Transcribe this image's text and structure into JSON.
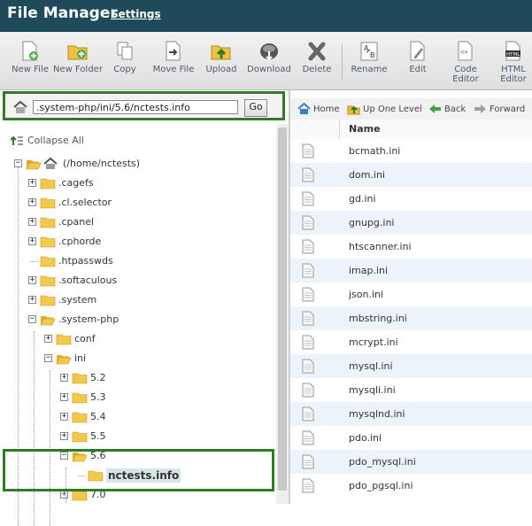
{
  "header": {
    "title": "File Manager",
    "settings_label": "Settings"
  },
  "toolbar": {
    "buttons": [
      {
        "label": "New File",
        "icon": "new-file-icon"
      },
      {
        "label": "New Folder",
        "icon": "new-folder-icon"
      },
      {
        "label": "Copy",
        "icon": "copy-icon"
      },
      {
        "label": "Move File",
        "icon": "move-file-icon"
      },
      {
        "label": "Upload",
        "icon": "upload-icon"
      },
      {
        "label": "Download",
        "icon": "download-icon"
      },
      {
        "label": "Delete",
        "icon": "delete-icon"
      },
      {
        "label": "Rename",
        "icon": "rename-icon"
      },
      {
        "label": "Edit",
        "icon": "edit-icon"
      },
      {
        "label": "Code Editor",
        "icon": "code-editor-icon"
      },
      {
        "label": "HTML Editor",
        "icon": "html-editor-icon"
      }
    ]
  },
  "path_bar": {
    "value": ".system-php/ini/5.6/nctests.info",
    "go_label": "Go"
  },
  "tree": {
    "collapse_all_label": "Collapse All",
    "root_label": "(/home/nctests)",
    "items": [
      {
        "label": ".cagefs",
        "level": 1,
        "expandable": true
      },
      {
        "label": ".cl.selector",
        "level": 1,
        "expandable": true
      },
      {
        "label": ".cpanel",
        "level": 1,
        "expandable": true
      },
      {
        "label": ".cphorde",
        "level": 1,
        "expandable": true
      },
      {
        "label": ".htpasswds",
        "level": 1,
        "expandable": false
      },
      {
        "label": ".softaculous",
        "level": 1,
        "expandable": true
      },
      {
        "label": ".system",
        "level": 1,
        "expandable": true
      },
      {
        "label": ".system-php",
        "level": 1,
        "expandable": true,
        "open": true
      },
      {
        "label": "conf",
        "level": 2,
        "expandable": true
      },
      {
        "label": "ini",
        "level": 2,
        "expandable": true,
        "open": true
      },
      {
        "label": "5.2",
        "level": 3,
        "expandable": true
      },
      {
        "label": "5.3",
        "level": 3,
        "expandable": true
      },
      {
        "label": "5.4",
        "level": 3,
        "expandable": true
      },
      {
        "label": "5.5",
        "level": 3,
        "expandable": true
      },
      {
        "label": "5.6",
        "level": 3,
        "expandable": true,
        "open": true
      },
      {
        "label": "nctests.info",
        "level": 4,
        "expandable": false,
        "selected": true
      },
      {
        "label": "7.0",
        "level": 3,
        "expandable": true
      }
    ]
  },
  "nav": {
    "home": "Home",
    "up": "Up One Level",
    "back": "Back",
    "forward": "Forward"
  },
  "files": {
    "column_name": "Name",
    "rows": [
      "bcmath.ini",
      "dom.ini",
      "gd.ini",
      "gnupg.ini",
      "htscanner.ini",
      "imap.ini",
      "json.ini",
      "mbstring.ini",
      "mcrypt.ini",
      "mysql.ini",
      "mysqli.ini",
      "mysqlnd.ini",
      "pdo.ini",
      "pdo_mysql.ini",
      "pdo_pgsql.ini"
    ]
  },
  "colors": {
    "header_bg": "#1e4a5a",
    "highlight": "#2e7d22",
    "folder": "#f0c040",
    "row_alt": "#ecf3fa"
  }
}
